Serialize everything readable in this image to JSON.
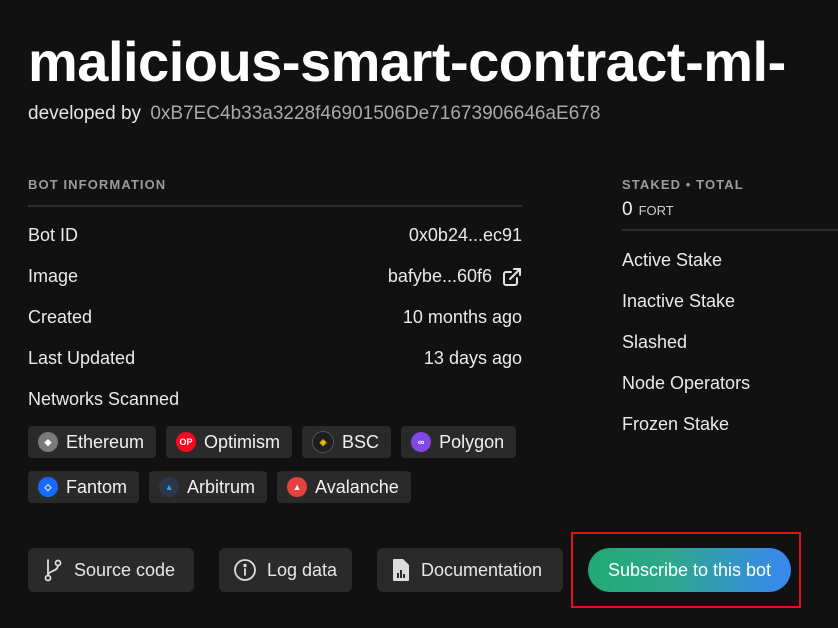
{
  "header": {
    "title": "malicious-smart-contract-ml-",
    "developed_by_label": "developed by",
    "developer_address": "0xB7EC4b33a3228f46901506De71673906646aE678"
  },
  "bot_info": {
    "heading": "BOT INFORMATION",
    "rows": [
      {
        "label": "Bot ID",
        "value": "0x0b24...ec91"
      },
      {
        "label": "Image",
        "value": "bafybe...60f6"
      },
      {
        "label": "Created",
        "value": "10 months ago"
      },
      {
        "label": "Last Updated",
        "value": "13 days ago"
      }
    ],
    "networks_label": "Networks Scanned",
    "networks": [
      {
        "name": "Ethereum",
        "color": "#8f8f8f"
      },
      {
        "name": "Optimism",
        "color": "#ff0420"
      },
      {
        "name": "BSC",
        "color": "#f0b90b"
      },
      {
        "name": "Polygon",
        "color": "#8247e5"
      },
      {
        "name": "Fantom",
        "color": "#1969ff"
      },
      {
        "name": "Arbitrum",
        "color": "#2d374b"
      },
      {
        "name": "Avalanche",
        "color": "#e84142"
      }
    ]
  },
  "stake": {
    "heading": "STAKED • TOTAL",
    "amount": "0",
    "unit": "FORT",
    "items": [
      "Active Stake",
      "Inactive Stake",
      "Slashed",
      "Node Operators",
      "Frozen Stake"
    ]
  },
  "actions": {
    "source_code": "Source code",
    "log_data": "Log data",
    "documentation": "Documentation",
    "subscribe": "Subscribe to this bot"
  }
}
